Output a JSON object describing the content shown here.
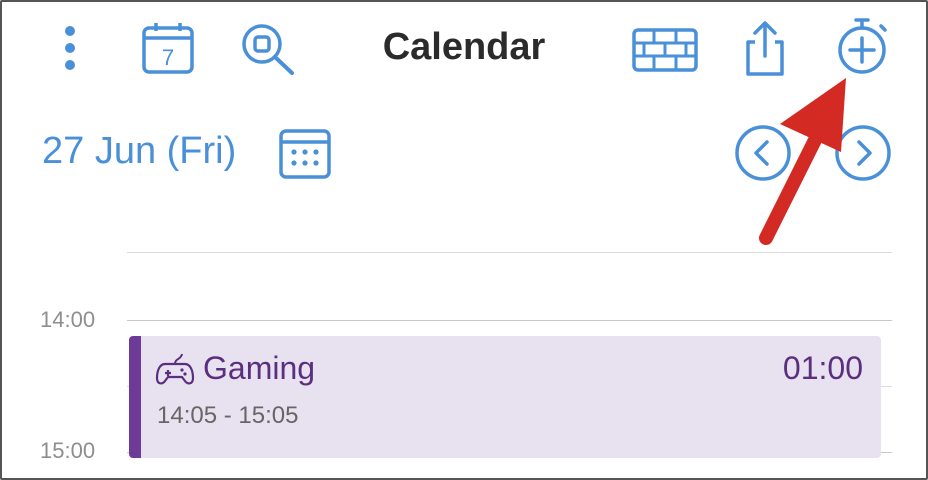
{
  "header": {
    "title": "Calendar",
    "icons": [
      "more-vertical-icon",
      "calendar-day-icon",
      "zoom-search-icon",
      "grid-view-icon",
      "share-icon",
      "add-timer-icon"
    ],
    "calendar_day_number": "7"
  },
  "date_bar": {
    "date": "27 Jun (Fri)",
    "icons": [
      "month-calendar-icon",
      "chevron-left-icon",
      "chevron-right-icon"
    ]
  },
  "timeline": {
    "hours": [
      "14:00",
      "15:00"
    ]
  },
  "event": {
    "icon": "gamepad-icon",
    "title": "Gaming",
    "duration": "01:00",
    "time_range": "14:05 - 15:05"
  },
  "colors": {
    "accent": "#4a90d9",
    "event_bg": "#e8e1f0",
    "event_bar": "#6d3b97",
    "event_text": "#5b2f80",
    "annotation_arrow": "#d42a24"
  }
}
